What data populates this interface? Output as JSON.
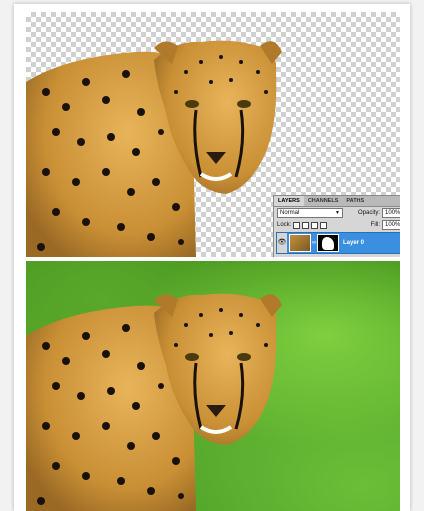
{
  "layers_panel": {
    "tabs": [
      "LAYERS",
      "CHANNELS",
      "PATHS"
    ],
    "menu_glyph": "≡",
    "blend_mode": "Normal",
    "opacity_label": "Opacity:",
    "opacity_value": "100%",
    "lock_label": "Lock:",
    "fill_label": "Fill:",
    "fill_value": "100%",
    "layer_name": "Layer 0"
  },
  "images": {
    "top": "cheetah-cutout-on-transparent",
    "bottom": "cheetah-on-grass"
  },
  "colors": {
    "selection": "#3a8fe0",
    "fur": "#d9a349",
    "spots": "#1a120a",
    "grass": "#4a9a24"
  }
}
